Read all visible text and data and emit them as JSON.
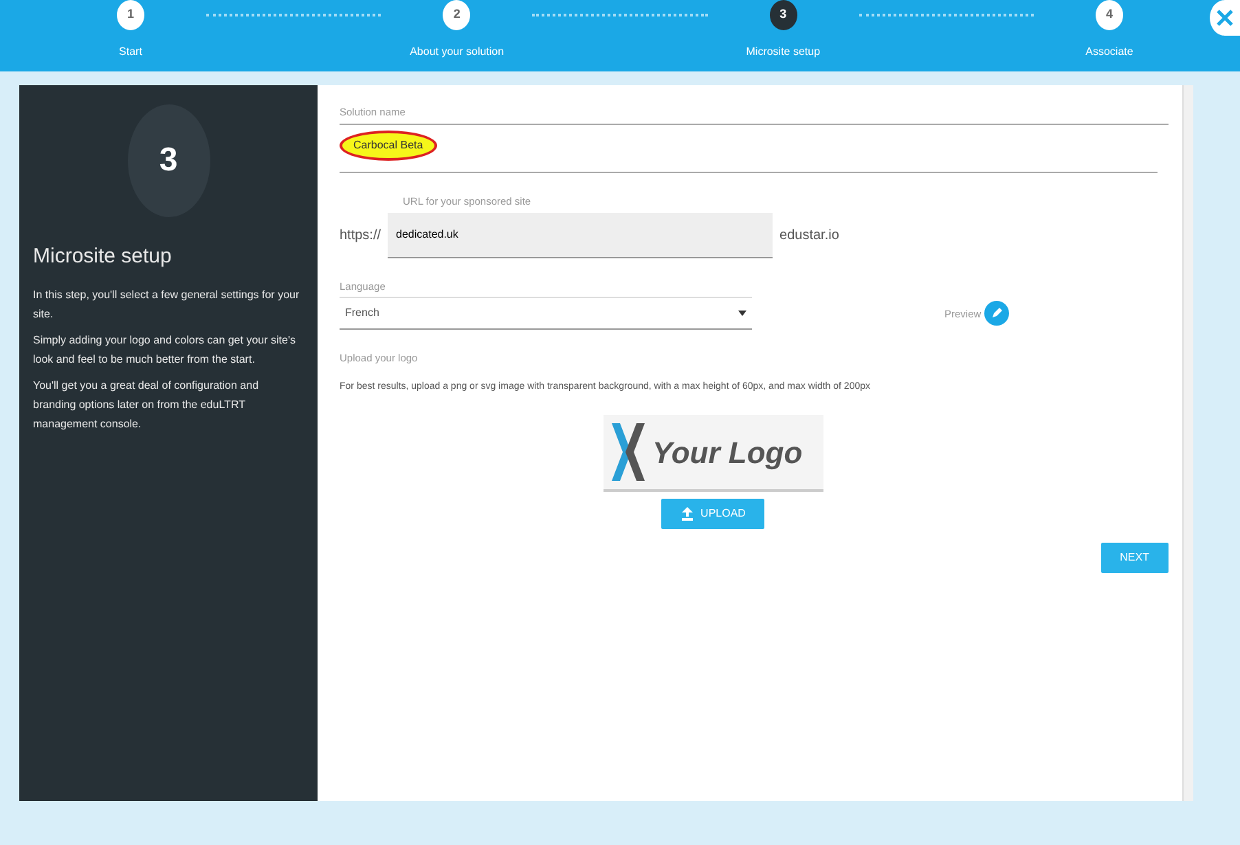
{
  "steps": [
    {
      "number": "1",
      "label": "Start",
      "selected": false
    },
    {
      "number": "2",
      "label": "About your solution",
      "selected": false
    },
    {
      "number": "3",
      "label": "Microsite setup",
      "selected": true
    },
    {
      "number": "4",
      "label": "Associate",
      "selected": false
    }
  ],
  "sidebar": {
    "number": "3",
    "title": "Microsite setup",
    "paragraphs": [
      "In this step, you'll select a few general settings for your site.",
      "Simply adding your logo and colors can get your site's look and feel to be much better from the start.",
      "You'll get you a great deal of configuration and branding options later on from the eduLTRT management console."
    ]
  },
  "solution_name": {
    "label": "Solution name",
    "value": "Carbocal Beta",
    "highlighted": true
  },
  "url": {
    "label": "URL for your sponsored site",
    "prefix": "https://",
    "value": "dedicated.uk",
    "suffix": "edustar.io"
  },
  "language": {
    "label": "Language",
    "value": "French",
    "preview": "Preview"
  },
  "logo": {
    "label": "Upload your logo",
    "hint": "For best results, upload a png or svg image with transparent background, with a max height of 60px, and max width of 200px",
    "preview_text": "Your Logo",
    "upload": "UPLOAD"
  },
  "next": "NEXT"
}
